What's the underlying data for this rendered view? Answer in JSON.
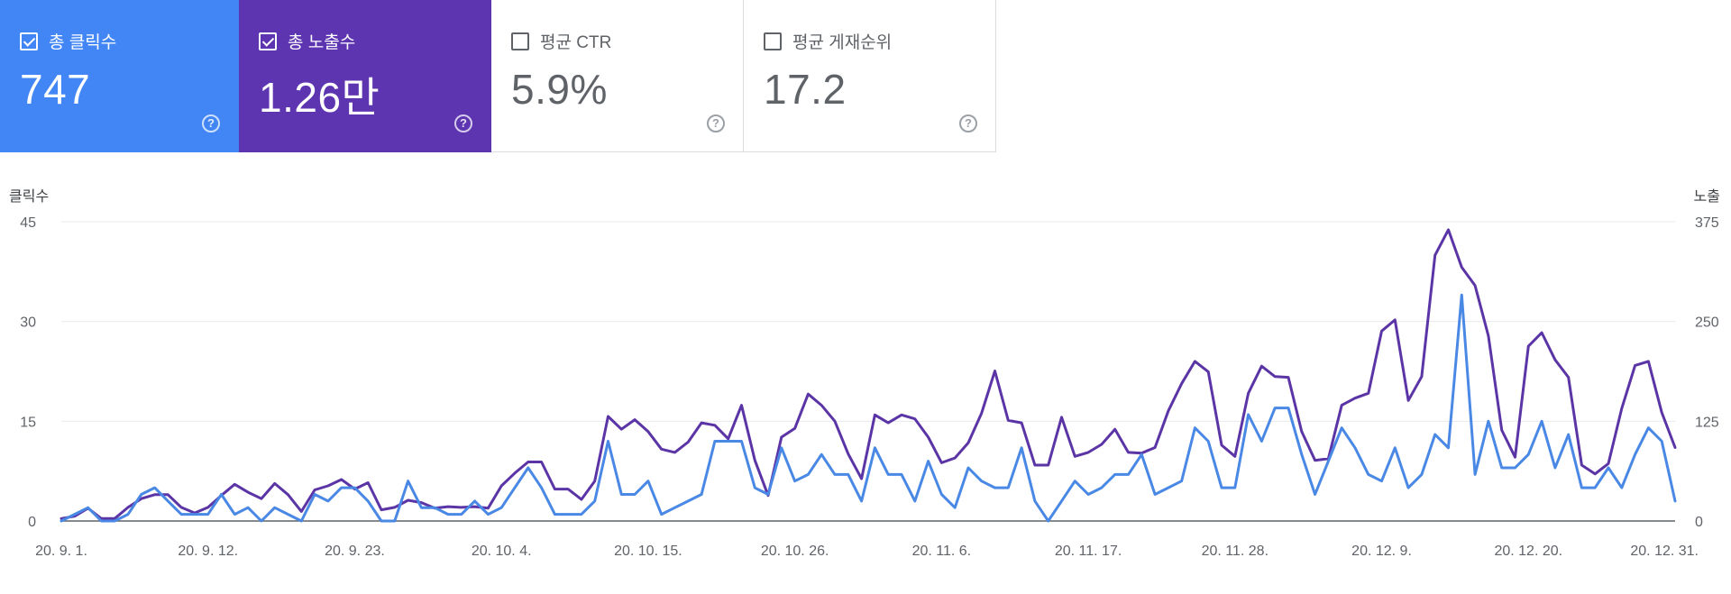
{
  "colors": {
    "clicks": "#4285f4",
    "clicks_line": "#4a88e5",
    "impressions": "#5e35b1",
    "impressions_line": "#5b35a6"
  },
  "cards": [
    {
      "id": "clicks",
      "label": "총 클릭수",
      "value": "747",
      "checked": true,
      "help_icon": "help-circle-icon"
    },
    {
      "id": "impressions",
      "label": "총 노출수",
      "value": "1.26만",
      "checked": true,
      "help_icon": "help-circle-icon"
    },
    {
      "id": "ctr",
      "label": "평균 CTR",
      "value": "5.9%",
      "checked": false,
      "help_icon": "help-circle-icon"
    },
    {
      "id": "position",
      "label": "평균 게재순위",
      "value": "17.2",
      "checked": false,
      "help_icon": "help-circle-icon"
    }
  ],
  "chart_data": {
    "type": "line",
    "title": "",
    "ylabel_left": "클릭수",
    "ylabel_right": "노출",
    "ylim_left": [
      0,
      45
    ],
    "ylim_right": [
      0,
      375
    ],
    "yticks_left": [
      "0",
      "15",
      "30",
      "45"
    ],
    "yticks_right": [
      "0",
      "125",
      "250",
      "375"
    ],
    "x_start": "2020-09-01",
    "x_end": "2020-12-31",
    "x_tick_labels": [
      "20. 9. 1.",
      "20. 9. 12.",
      "20. 9. 23.",
      "20. 10. 4.",
      "20. 10. 15.",
      "20. 10. 26.",
      "20. 11. 6.",
      "20. 11. 17.",
      "20. 11. 28.",
      "20. 12. 9.",
      "20. 12. 20.",
      "20. 12. 31."
    ],
    "grid": true,
    "series": [
      {
        "name": "총 노출수",
        "axis": "right",
        "values": [
          3,
          6,
          16,
          3,
          3,
          17,
          28,
          33,
          33,
          17,
          10,
          17,
          32,
          46,
          36,
          28,
          47,
          33,
          12,
          39,
          44,
          52,
          40,
          48,
          14,
          17,
          26,
          23,
          16,
          18,
          17,
          18,
          16,
          44,
          60,
          74,
          74,
          40,
          40,
          27,
          50,
          131,
          115,
          127,
          112,
          90,
          86,
          99,
          123,
          120,
          103,
          145,
          76,
          32,
          105,
          116,
          159,
          145,
          125,
          84,
          53,
          133,
          123,
          133,
          128,
          105,
          73,
          79,
          98,
          135,
          188,
          126,
          123,
          70,
          70,
          130,
          81,
          86,
          96,
          115,
          86,
          85,
          92,
          138,
          172,
          200,
          187,
          95,
          81,
          160,
          194,
          181,
          180,
          112,
          76,
          78,
          145,
          154,
          160,
          238,
          252,
          151,
          181,
          333,
          365,
          318,
          295,
          232,
          114,
          80,
          219,
          236,
          202,
          180,
          70,
          59,
          72,
          141,
          195,
          200,
          136,
          92
        ]
      },
      {
        "name": "총 클릭수",
        "axis": "left",
        "values": [
          0,
          1,
          2,
          0,
          0,
          1,
          4,
          5,
          3,
          1,
          1,
          1,
          4,
          1,
          2,
          0,
          2,
          1,
          0,
          4,
          3,
          5,
          5,
          3,
          0,
          0,
          6,
          2,
          2,
          1,
          1,
          3,
          1,
          2,
          5,
          8,
          5,
          1,
          1,
          1,
          3,
          12,
          4,
          4,
          6,
          1,
          2,
          3,
          4,
          12,
          12,
          12,
          5,
          4,
          11,
          6,
          7,
          10,
          7,
          7,
          3,
          11,
          7,
          7,
          3,
          9,
          4,
          2,
          8,
          6,
          5,
          5,
          11,
          3,
          0,
          3,
          6,
          4,
          5,
          7,
          7,
          10,
          4,
          5,
          6,
          14,
          12,
          5,
          5,
          16,
          12,
          17,
          17,
          10,
          4,
          9,
          14,
          11,
          7,
          6,
          11,
          5,
          7,
          13,
          11,
          34,
          7,
          15,
          8,
          8,
          10,
          15,
          8,
          13,
          5,
          5,
          8,
          5,
          10,
          14,
          12,
          3
        ]
      }
    ]
  }
}
